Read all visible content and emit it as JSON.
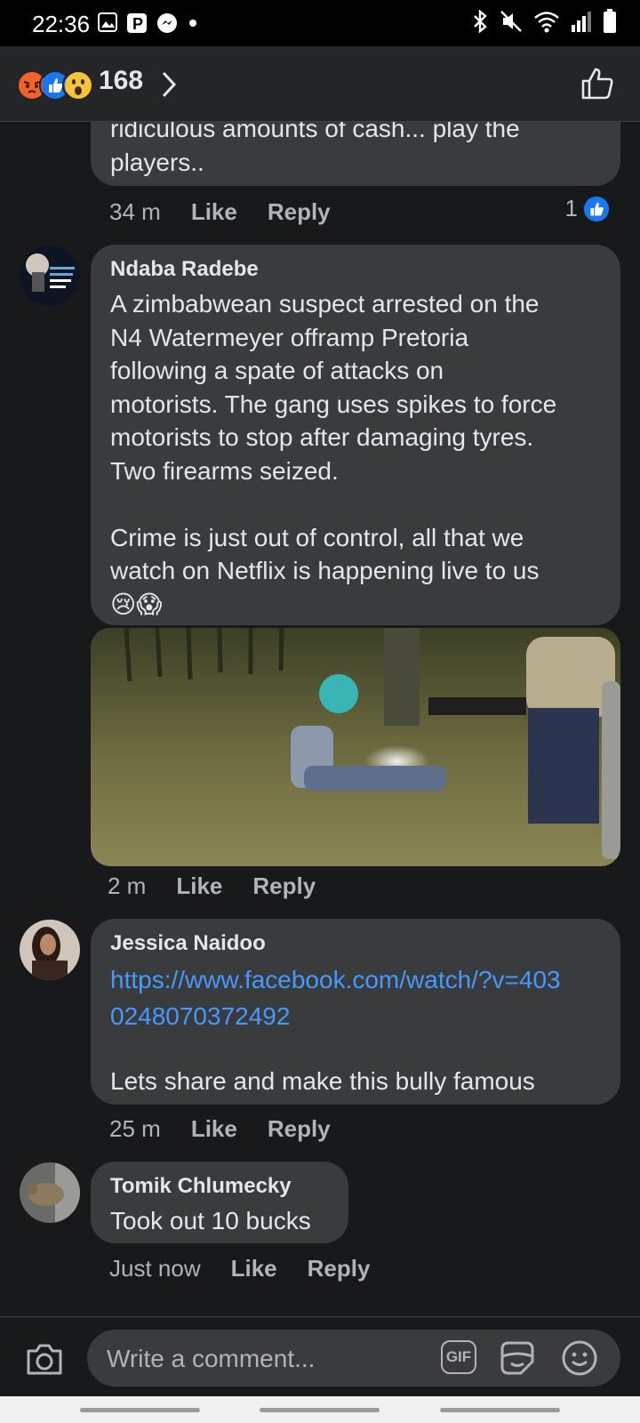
{
  "status_bar": {
    "time": "22:36"
  },
  "reactions_header": {
    "count": "168"
  },
  "comments": [
    {
      "text": "ridiculous amounts of cash... play the\nplayers..",
      "time": "34 m",
      "like_label": "Like",
      "reply_label": "Reply",
      "like_count": "1"
    },
    {
      "author": "Ndaba Radebe",
      "text": "A zimbabwean suspect arrested on the\nN4 Watermeyer offramp Pretoria\nfollowing a spate of attacks on\nmotorists. The gang uses spikes to force\nmotorists to stop after damaging tyres.\nTwo firearms seized.\n\nCrime is just out of control, all that we\nwatch on Netflix is happening live to us",
      "emoji": "😢😱",
      "time": "2 m",
      "like_label": "Like",
      "reply_label": "Reply"
    },
    {
      "author": "Jessica Naidoo",
      "link": "https://www.facebook.com/watch/?v=4030248070372492",
      "text": "Lets share and make this bully famous",
      "time": "25 m",
      "like_label": "Like",
      "reply_label": "Reply"
    },
    {
      "author": "Tomik Chlumecky",
      "text": "Took out 10 bucks",
      "time": "Just now",
      "like_label": "Like",
      "reply_label": "Reply"
    }
  ],
  "composer": {
    "placeholder": "Write a comment...",
    "gif_label": "GIF"
  },
  "colors": {
    "background": "#18191a",
    "bubble": "#3a3b3c",
    "link": "#4599ff",
    "like_blue": "#1877f2"
  }
}
